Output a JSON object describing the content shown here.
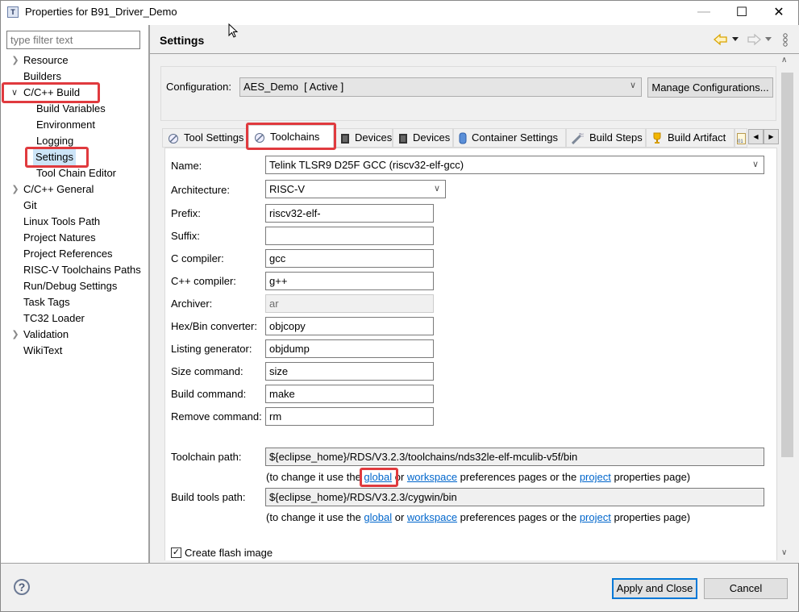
{
  "window": {
    "title": "Properties for B91_Driver_Demo",
    "minimize_label": "—",
    "maximize_label": "☐",
    "close_label": "✕"
  },
  "sidebar": {
    "filter_placeholder": "type filter text",
    "items": [
      {
        "label": "Resource",
        "expandable": true,
        "expanded": false,
        "level": 0
      },
      {
        "label": "Builders",
        "expandable": false,
        "level": 0
      },
      {
        "label": "C/C++ Build",
        "expandable": true,
        "expanded": true,
        "level": 0
      },
      {
        "label": "Build Variables",
        "level": 1
      },
      {
        "label": "Environment",
        "level": 1
      },
      {
        "label": "Logging",
        "level": 1
      },
      {
        "label": "Settings",
        "level": 1,
        "selected": true
      },
      {
        "label": "Tool Chain Editor",
        "level": 1
      },
      {
        "label": "C/C++ General",
        "expandable": true,
        "expanded": false,
        "level": 0
      },
      {
        "label": "Git",
        "level": 0
      },
      {
        "label": "Linux Tools Path",
        "level": 0
      },
      {
        "label": "Project Natures",
        "level": 0
      },
      {
        "label": "Project References",
        "level": 0
      },
      {
        "label": "RISC-V Toolchains Paths",
        "level": 0
      },
      {
        "label": "Run/Debug Settings",
        "level": 0
      },
      {
        "label": "Task Tags",
        "level": 0
      },
      {
        "label": "TC32 Loader",
        "level": 0
      },
      {
        "label": "Validation",
        "expandable": true,
        "expanded": false,
        "level": 0
      },
      {
        "label": "WikiText",
        "level": 0
      }
    ]
  },
  "header": {
    "title": "Settings"
  },
  "configuration": {
    "label": "Configuration:",
    "value": "AES_Demo  [ Active ]",
    "manage_button": "Manage Configurations..."
  },
  "tabs": [
    {
      "label": "Tool Settings",
      "icon": "tool-settings-icon"
    },
    {
      "label": "Toolchains",
      "icon": "toolchains-icon",
      "active": true
    },
    {
      "label": "Devices",
      "icon": "chip-icon"
    },
    {
      "label": "Devices",
      "icon": "chip-icon"
    },
    {
      "label": "Container Settings",
      "icon": "container-icon"
    },
    {
      "label": "Build Steps",
      "icon": "build-steps-icon"
    },
    {
      "label": "Build Artifact",
      "icon": "trophy-icon"
    }
  ],
  "toolchain": {
    "fields": [
      {
        "label": "Name:",
        "value": "Telink TLSR9 D25F GCC (riscv32-elf-gcc)",
        "type": "select"
      },
      {
        "label": "Architecture:",
        "value": "RISC-V",
        "type": "select"
      },
      {
        "label": "Prefix:",
        "value": "riscv32-elf-"
      },
      {
        "label": "Suffix:",
        "value": ""
      },
      {
        "label": "C compiler:",
        "value": "gcc"
      },
      {
        "label": "C++ compiler:",
        "value": "g++"
      },
      {
        "label": "Archiver:",
        "value": "ar",
        "disabled": true
      },
      {
        "label": "Hex/Bin converter:",
        "value": "objcopy"
      },
      {
        "label": "Listing generator:",
        "value": "objdump"
      },
      {
        "label": "Size command:",
        "value": "size"
      },
      {
        "label": "Build command:",
        "value": "make"
      },
      {
        "label": "Remove command:",
        "value": "rm"
      }
    ],
    "toolchain_path_label": "Toolchain path:",
    "toolchain_path": "${eclipse_home}/RDS/V3.2.3/toolchains/nds32le-elf-mculib-v5f/bin",
    "build_tools_path_label": "Build tools path:",
    "build_tools_path": "${eclipse_home}/RDS/V3.2.3/cygwin/bin",
    "note_prefix": "(to change it use the ",
    "link_global": "global",
    "note_or": " or ",
    "link_workspace": "workspace",
    "note_mid": " preferences pages or the ",
    "link_project": "project",
    "note_suffix": " properties page)",
    "create_flash_label": "Create flash image",
    "create_flash_checked": true
  },
  "footer": {
    "apply_close": "Apply and Close",
    "cancel": "Cancel",
    "help": "?"
  },
  "scroll": {
    "position_fraction": 0.0,
    "visible_fraction": 0.78
  }
}
